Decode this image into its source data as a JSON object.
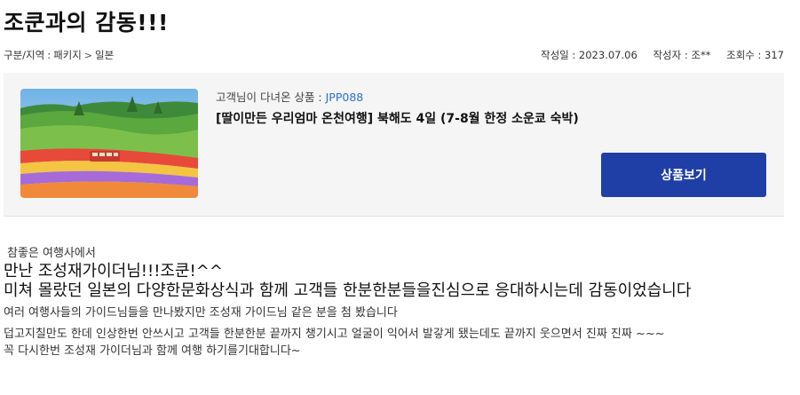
{
  "post": {
    "title": "조쿤과의 감동!!!"
  },
  "breadcrumb": {
    "items": [
      "구분/지역",
      "패키지",
      "일본"
    ],
    "sep": ":",
    "chevron": ">"
  },
  "meta": {
    "date_label": "작성일 : 2023.07.06",
    "author_label": "작성자 : 조**",
    "views_label": "조회수 : 317"
  },
  "product": {
    "label_prefix": "고객님이 다녀온 상품 : ",
    "code": "JPP088",
    "name": "[딸이만든 우리엄마 온천여행] 북해도 4일 (7-8월 한정 소운쿄 숙박)",
    "button_label": "상품보기",
    "thumbnail_icon": "flower-field-photo"
  },
  "review": {
    "line1": "참좋은 여행사에서",
    "line2": "만난 조성재가이더님!!!조쿤!^^",
    "line3": "미쳐 몰랐던 일본의 다양한문화상식과 함께 고객들 한분한분들을진심으로 응대하시는데 감동이었습니다",
    "line4": "여러 여행사들의 가이드님들을 만나봤지만 조성재 가이드님 같은 분을 첨 봤습니다",
    "line5": "덥고지칠만도 한데 인상한번 안쓰시고 고객들 한분한분  끝까지 챙기시고 얼굴이 익어서 발갛게 됐는데도 끝까지 웃으면서  진짜 진짜 ~~~",
    "line6": "꼭 다시한번 조성재 가이더님과 함께 여행 하기를기대합니다~"
  },
  "colors": {
    "button_bg": "#1f3fa6",
    "code_text": "#2d6fd6",
    "box_bg": "#f5f5f5"
  }
}
